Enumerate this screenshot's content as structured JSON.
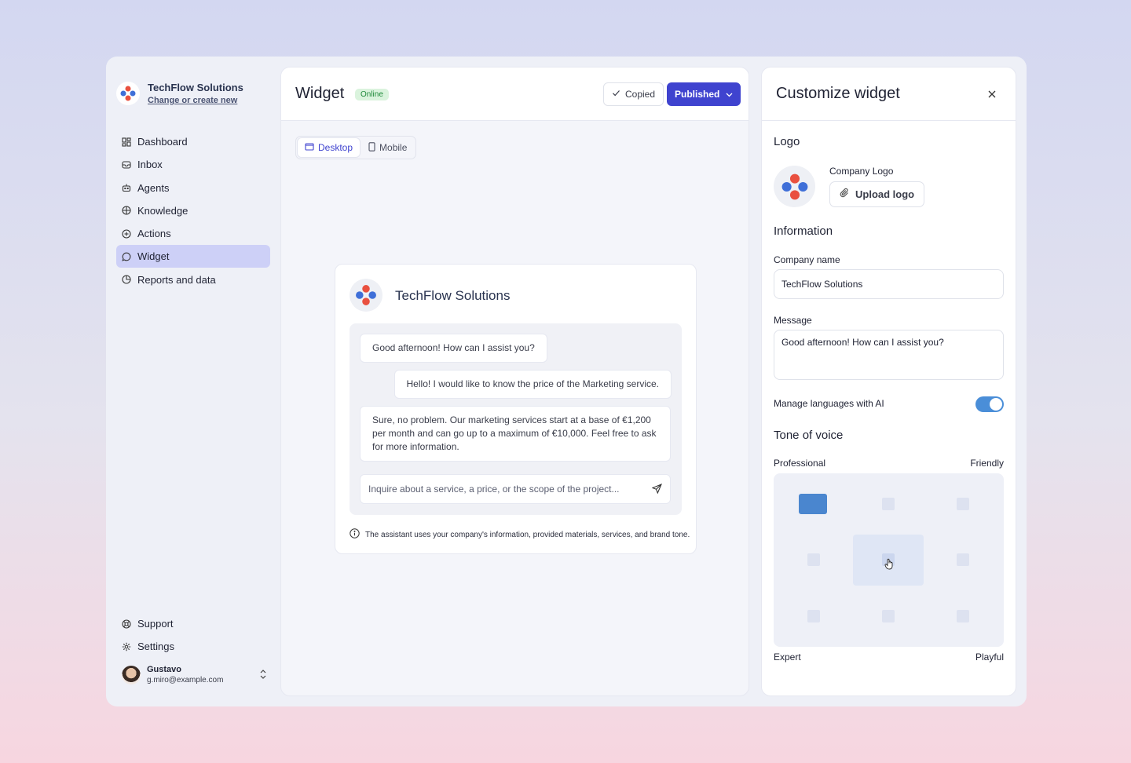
{
  "org": {
    "name": "TechFlow Solutions",
    "switch_link": "Change or create new"
  },
  "nav": {
    "items": [
      {
        "label": "Dashboard",
        "icon": "grid-icon"
      },
      {
        "label": "Inbox",
        "icon": "inbox-icon"
      },
      {
        "label": "Agents",
        "icon": "robot-icon"
      },
      {
        "label": "Knowledge",
        "icon": "book-icon"
      },
      {
        "label": "Actions",
        "icon": "plus-circle-icon"
      },
      {
        "label": "Widget",
        "icon": "chat-bubble-icon",
        "active": true
      },
      {
        "label": "Reports and data",
        "icon": "pie-chart-icon"
      }
    ],
    "bottom": [
      {
        "label": "Support",
        "icon": "lifebuoy-icon"
      },
      {
        "label": "Settings",
        "icon": "gear-icon"
      }
    ]
  },
  "user": {
    "name": "Gustavo",
    "email": "g.miro@example.com"
  },
  "main": {
    "title": "Widget",
    "status_badge": "Online",
    "copied_label": "Copied",
    "published_label": "Published",
    "device_tabs": [
      {
        "label": "Desktop",
        "active": true
      },
      {
        "label": "Mobile",
        "active": false
      }
    ]
  },
  "preview": {
    "company": "TechFlow Solutions",
    "messages": [
      "Good afternoon! How can I assist you?",
      "Hello! I would like to know the price of the Marketing service.",
      "Sure, no problem. Our marketing services start at a base of €1,200 per month and can go up to a maximum of €10,000. Feel free to ask for more information."
    ],
    "input_placeholder": "Inquire about a service, a price, or the scope of the project...",
    "note": "The assistant uses your company's information, provided materials, services, and brand tone."
  },
  "panel": {
    "title": "Customize widget",
    "logo_section": "Logo",
    "company_logo_label": "Company Logo",
    "upload_label": "Upload logo",
    "info_section": "Information",
    "company_name_label": "Company name",
    "company_name_value": "TechFlow Solutions",
    "message_label": "Message",
    "message_value": "Good afternoon! How can I assist you?",
    "languages_label": "Manage languages with AI",
    "languages_enabled": true,
    "tone_section": "Tone of voice",
    "tone_axes": {
      "top_left": "Professional",
      "top_right": "Friendly",
      "bottom_left": "Expert",
      "bottom_right": "Playful"
    },
    "tone_selected": {
      "row": 1,
      "col": 1
    }
  },
  "colors": {
    "accent": "#3f43cf",
    "active_nav": "#cdd0f7",
    "toggle": "#4a8ed8",
    "online": "#1f8a3a"
  }
}
